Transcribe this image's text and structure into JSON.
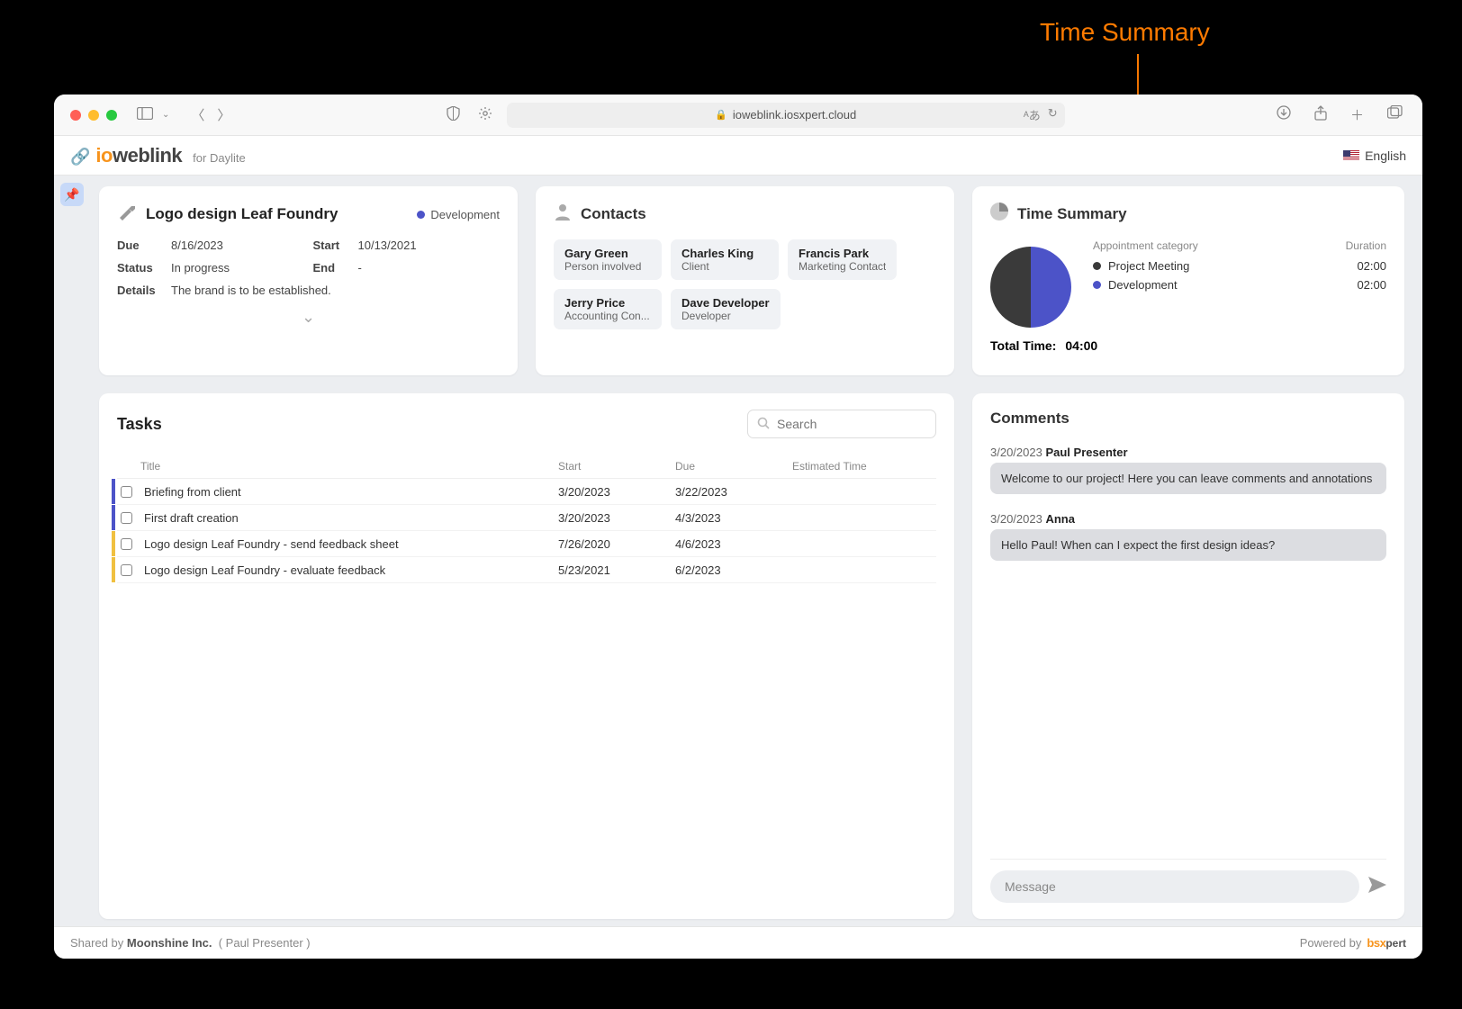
{
  "annotation": {
    "label": "Time Summary"
  },
  "browser": {
    "url_host": "ioweblink.iosxpert.cloud"
  },
  "header": {
    "brand_part1": "io",
    "brand_part2": "weblink",
    "brand_sub": "for Daylite",
    "language": "English"
  },
  "project": {
    "title": "Logo design Leaf Foundry",
    "tag": "Development",
    "due_label": "Due",
    "due": "8/16/2023",
    "start_label": "Start",
    "start": "10/13/2021",
    "status_label": "Status",
    "status": "In progress",
    "end_label": "End",
    "end": "-",
    "details_label": "Details",
    "details": "The brand is to be established."
  },
  "contacts": {
    "heading": "Contacts",
    "items": [
      {
        "name": "Gary Green",
        "role": "Person involved"
      },
      {
        "name": "Charles King",
        "role": "Client"
      },
      {
        "name": "Francis Park",
        "role": "Marketing Contact"
      },
      {
        "name": "Jerry Price",
        "role": "Accounting Con..."
      },
      {
        "name": "Dave Developer",
        "role": "Developer"
      }
    ]
  },
  "time_summary": {
    "heading": "Time Summary",
    "col_category": "Appointment category",
    "col_duration": "Duration",
    "rows": [
      {
        "label": "Project Meeting",
        "duration": "02:00",
        "dotClass": "dark"
      },
      {
        "label": "Development",
        "duration": "02:00",
        "dotClass": "blue"
      }
    ],
    "total_label": "Total Time:",
    "total_value": "04:00"
  },
  "chart_data": {
    "type": "pie",
    "title": "Time Summary",
    "series": [
      {
        "name": "Project Meeting",
        "value": 2.0,
        "color": "#3a3a3a"
      },
      {
        "name": "Development",
        "value": 2.0,
        "color": "#4c53c8"
      }
    ],
    "unit": "hours",
    "total": 4.0
  },
  "tasks": {
    "heading": "Tasks",
    "search_placeholder": "Search",
    "cols": {
      "title": "Title",
      "start": "Start",
      "due": "Due",
      "est": "Estimated Time"
    },
    "rows": [
      {
        "bar": "blue",
        "title": "Briefing from client",
        "start": "3/20/2023",
        "due": "3/22/2023",
        "est": ""
      },
      {
        "bar": "blue",
        "title": "First draft creation",
        "start": "3/20/2023",
        "due": "4/3/2023",
        "est": ""
      },
      {
        "bar": "yellow",
        "title": "Logo design Leaf Foundry - send feedback sheet",
        "start": "7/26/2020",
        "due": "4/6/2023",
        "est": ""
      },
      {
        "bar": "yellow",
        "title": "Logo design Leaf Foundry - evaluate feedback",
        "start": "5/23/2021",
        "due": "6/2/2023",
        "est": ""
      }
    ]
  },
  "comments": {
    "heading": "Comments",
    "items": [
      {
        "date": "3/20/2023",
        "author": "Paul Presenter",
        "text": "Welcome to our project! Here you can leave comments and annotations"
      },
      {
        "date": "3/20/2023",
        "author": "Anna",
        "text": "Hello Paul! When can I expect the first design ideas?"
      }
    ],
    "message_placeholder": "Message"
  },
  "footer": {
    "shared_by_prefix": "Shared by ",
    "shared_by_company": "Moonshine Inc.",
    "shared_by_user": "( Paul Presenter )",
    "powered_by": "Powered by"
  }
}
